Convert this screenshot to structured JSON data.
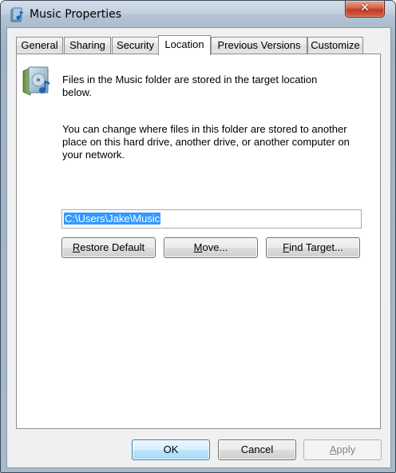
{
  "window": {
    "title": "Music Properties",
    "close_label": "✕"
  },
  "tabs": [
    {
      "label": "General"
    },
    {
      "label": "Sharing"
    },
    {
      "label": "Security"
    },
    {
      "label": "Location"
    },
    {
      "label": "Previous Versions"
    },
    {
      "label": "Customize"
    }
  ],
  "active_tab": "Location",
  "location": {
    "line1": "Files in the Music folder are stored in the target location below.",
    "line2": "You can change where files in this folder are stored to another place on this hard drive, another drive, or another computer on your network.",
    "path": "C:\\Users\\Jake\\Music",
    "restore_pre": "",
    "restore_key": "R",
    "restore_post": "estore Default",
    "move_pre": "",
    "move_key": "M",
    "move_post": "ove...",
    "find_pre": "",
    "find_key": "F",
    "find_post": "ind Target..."
  },
  "footer": {
    "ok": "OK",
    "cancel": "Cancel",
    "apply_pre": "",
    "apply_key": "A",
    "apply_post": "pply"
  },
  "icons": {
    "title": "music-folder-icon",
    "folder": "music-folder-icon"
  }
}
